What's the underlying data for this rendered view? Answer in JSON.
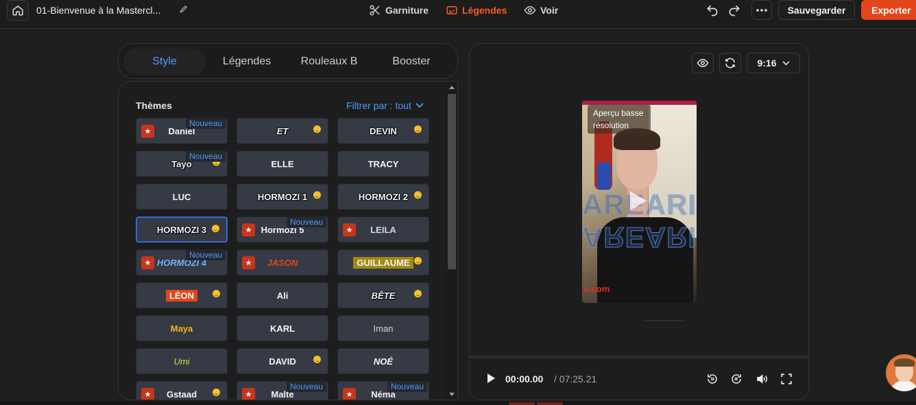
{
  "topbar": {
    "project_title": "01-Bienvenue à la Mastercl...",
    "nav": [
      {
        "label": "Garniture",
        "icon": "scissors-icon"
      },
      {
        "label": "Légendes",
        "icon": "captions-icon",
        "active": true
      },
      {
        "label": "Voir",
        "icon": "eye-icon"
      }
    ],
    "save_label": "Sauvegarder",
    "export_label": "Exporter",
    "accent": "#ff5a1f"
  },
  "left": {
    "tabs": [
      "Style",
      "Légendes",
      "Rouleaux B",
      "Booster"
    ],
    "active_tab": "Style",
    "themes_label": "Thèmes",
    "filter_label": "Filtrer par : tout",
    "new_badge": "Nouveau",
    "themes": [
      {
        "label": "Daniel",
        "star": true,
        "new": true
      },
      {
        "label": "ET",
        "emoji": true
      },
      {
        "label": "DEVIN",
        "emoji": true
      },
      {
        "label": "Tayo",
        "new": true,
        "emoji": true
      },
      {
        "label": "ELLE"
      },
      {
        "label": "TRACY"
      },
      {
        "label": "LUC"
      },
      {
        "label": "HORMOZI 1",
        "emoji": true
      },
      {
        "label": "HORMOZI 2",
        "emoji": true
      },
      {
        "label": "HORMOZI 3",
        "emoji": true,
        "selected": true
      },
      {
        "label": "Hormozi 5",
        "star": true,
        "new": true
      },
      {
        "label": "LEILA",
        "star": true
      },
      {
        "label": "HORMOZI 4",
        "star": true,
        "new": true
      },
      {
        "label": "JASON",
        "star": true
      },
      {
        "label": "GUILLAUME",
        "emoji": true
      },
      {
        "label": "LÉON",
        "emoji": true
      },
      {
        "label": "Ali"
      },
      {
        "label": "BÊTE",
        "emoji": true
      },
      {
        "label": "Maya"
      },
      {
        "label": "KARL"
      },
      {
        "label": "Iman"
      },
      {
        "label": "Umi"
      },
      {
        "label": "DAVID",
        "emoji": true
      },
      {
        "label": "NOÉ"
      },
      {
        "label": "Gstaad",
        "star": true,
        "emoji": true
      },
      {
        "label": "Malte",
        "star": true,
        "new": true
      },
      {
        "label": "Néma",
        "star": true,
        "new": true
      }
    ]
  },
  "preview": {
    "aspect": "9:16",
    "low_res_label": "Aperçu basse résolution",
    "overlay_text": "AREARI",
    "url_fragment": "o.com",
    "time_current": "00:00.00",
    "time_total": "/ 07:25.21"
  }
}
